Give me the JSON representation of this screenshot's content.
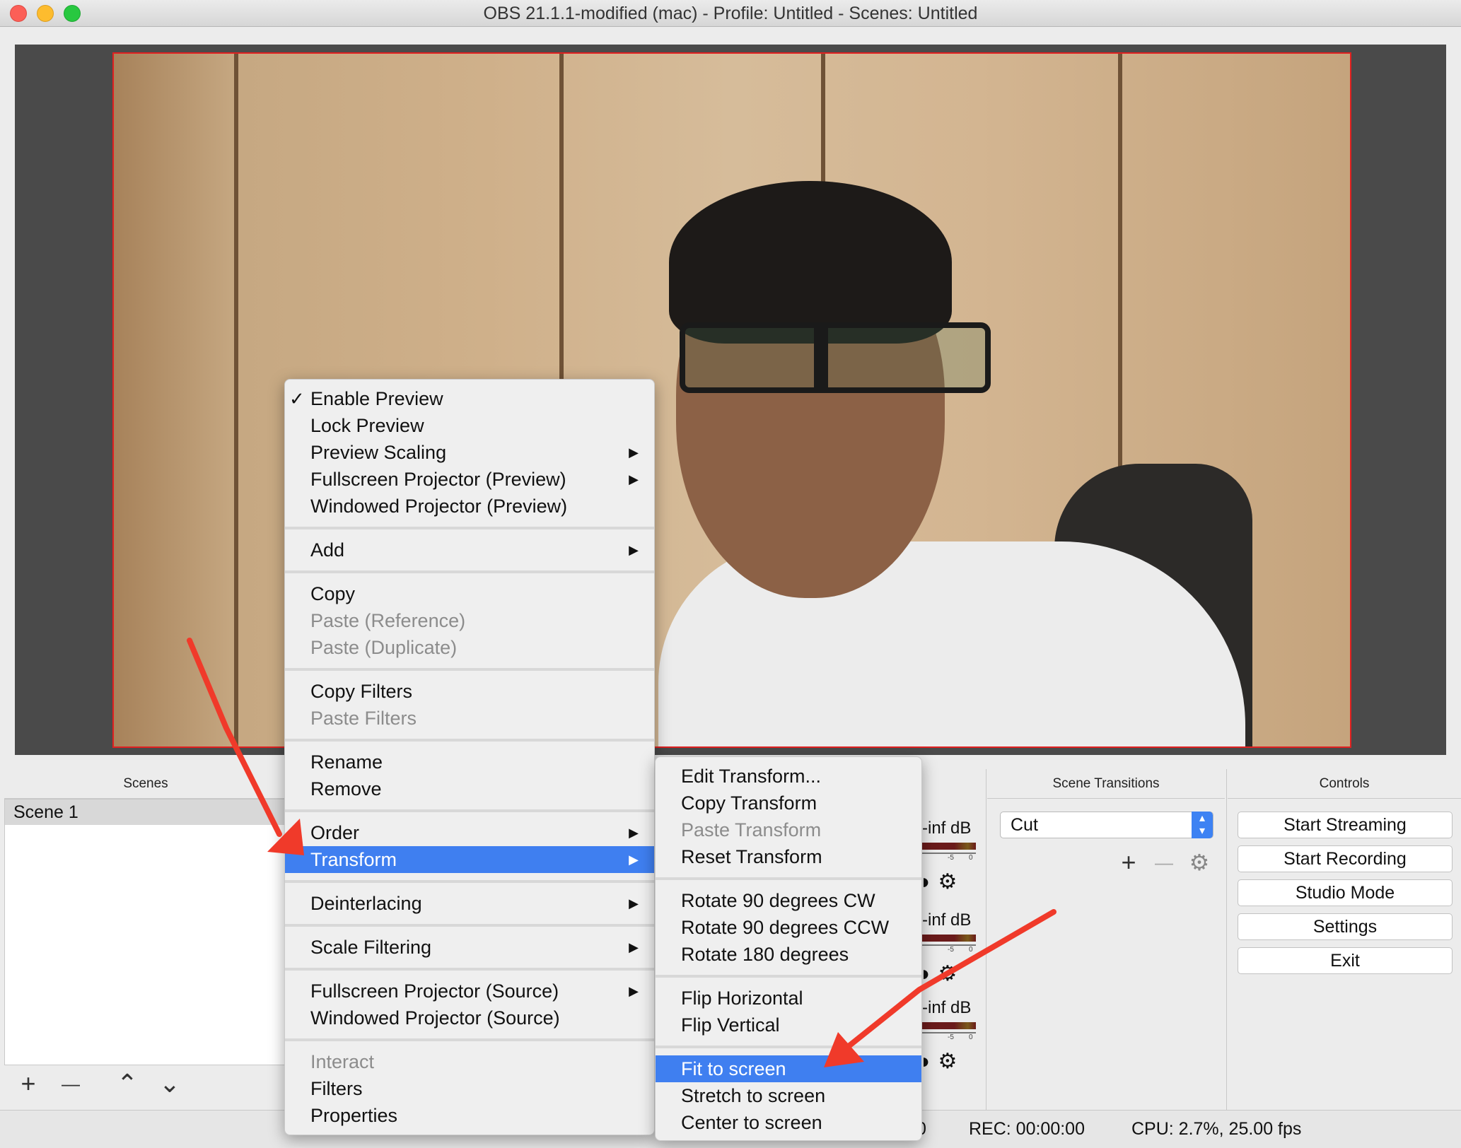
{
  "window": {
    "title": "OBS 21.1.1-modified (mac) - Profile: Untitled - Scenes: Untitled"
  },
  "docks": {
    "scenes_title": "Scenes",
    "transitions_title": "Scene Transitions",
    "controls_title": "Controls"
  },
  "scenes": {
    "items": [
      "Scene 1"
    ],
    "toolbar": {
      "add": "+",
      "remove": "—",
      "up": "⌃",
      "down": "⌄"
    }
  },
  "mixer": {
    "channels": [
      {
        "db": "-inf dB",
        "tick": "-5",
        "tick_end": "0"
      },
      {
        "db": "-inf dB",
        "tick": "-5",
        "tick_end": "0"
      },
      {
        "db": "-inf dB",
        "tick": "-5",
        "tick_end": "0"
      }
    ]
  },
  "transitions": {
    "selected": "Cut",
    "add": "+",
    "remove": "—"
  },
  "controls": {
    "start_streaming": "Start Streaming",
    "start_recording": "Start Recording",
    "studio_mode": "Studio Mode",
    "settings": "Settings",
    "exit": "Exit"
  },
  "status": {
    "live": "0",
    "rec": "REC: 00:00:00",
    "cpu": "CPU: 2.7%, 25.00 fps"
  },
  "context_menu": {
    "enable_preview": "Enable Preview",
    "lock_preview": "Lock Preview",
    "preview_scaling": "Preview Scaling",
    "fullscreen_projector_preview": "Fullscreen Projector (Preview)",
    "windowed_projector_preview": "Windowed Projector (Preview)",
    "add": "Add",
    "copy": "Copy",
    "paste_reference": "Paste (Reference)",
    "paste_duplicate": "Paste (Duplicate)",
    "copy_filters": "Copy Filters",
    "paste_filters": "Paste Filters",
    "rename": "Rename",
    "remove": "Remove",
    "order": "Order",
    "transform": "Transform",
    "deinterlacing": "Deinterlacing",
    "scale_filtering": "Scale Filtering",
    "fullscreen_projector_source": "Fullscreen Projector (Source)",
    "windowed_projector_source": "Windowed Projector (Source)",
    "interact": "Interact",
    "filters": "Filters",
    "properties": "Properties"
  },
  "transform_menu": {
    "edit_transform": "Edit Transform...",
    "copy_transform": "Copy Transform",
    "paste_transform": "Paste Transform",
    "reset_transform": "Reset Transform",
    "rotate_cw": "Rotate 90 degrees CW",
    "rotate_ccw": "Rotate 90 degrees CCW",
    "rotate_180": "Rotate 180 degrees",
    "flip_horizontal": "Flip Horizontal",
    "flip_vertical": "Flip Vertical",
    "fit_to_screen": "Fit to screen",
    "stretch_to_screen": "Stretch to screen",
    "center_to_screen": "Center to screen"
  },
  "colors": {
    "highlight": "#3f7ff0",
    "annotation_arrow": "#f03a2a",
    "selection_border": "#e02020"
  }
}
